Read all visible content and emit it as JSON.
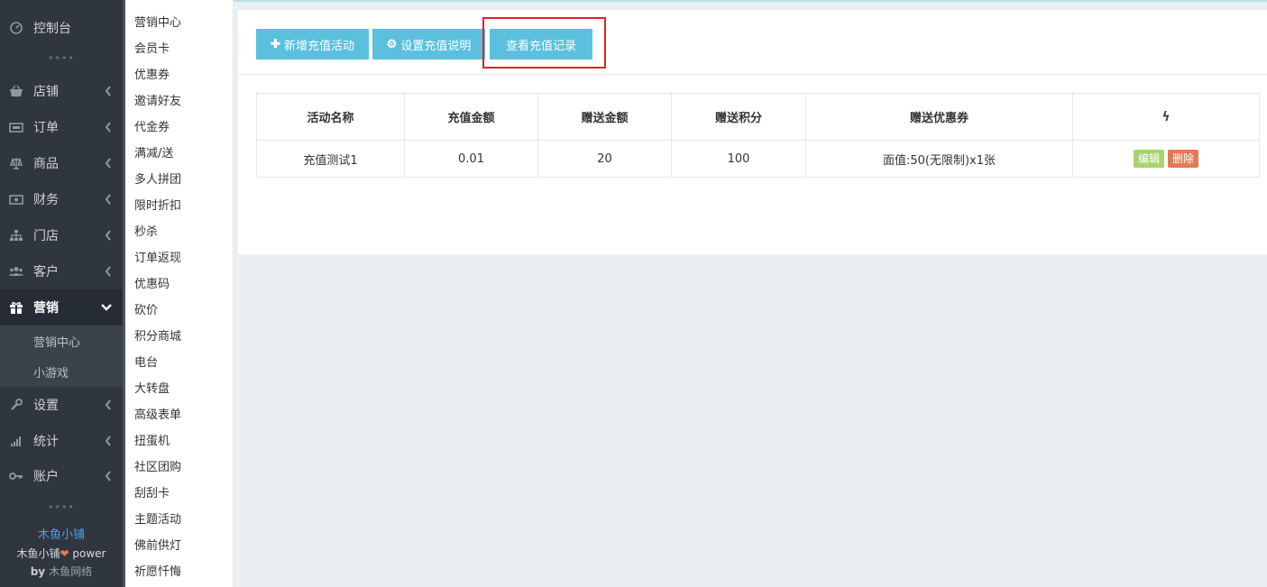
{
  "sidebar": {
    "items": [
      {
        "label": "控制台",
        "icon": "dashboard-icon"
      },
      {
        "label": "店铺",
        "icon": "basket-icon"
      },
      {
        "label": "订单",
        "icon": "ticket-icon"
      },
      {
        "label": "商品",
        "icon": "balance-scale-icon"
      },
      {
        "label": "财务",
        "icon": "money-icon"
      },
      {
        "label": "门店",
        "icon": "sitemap-icon"
      },
      {
        "label": "客户",
        "icon": "users-icon"
      },
      {
        "label": "营销",
        "icon": "gift-icon"
      },
      {
        "label": "设置",
        "icon": "wrench-icon"
      },
      {
        "label": "统计",
        "icon": "signal-icon"
      },
      {
        "label": "账户",
        "icon": "key-icon"
      }
    ],
    "sub_items": [
      "营销中心",
      "小游戏"
    ],
    "dots": "••••",
    "footer": {
      "brand": "木鱼小铺",
      "power_prefix": "木鱼小铺",
      "power_suffix": " power",
      "by_prefix": "by ",
      "by_name": "木鱼网络"
    }
  },
  "submenu": {
    "items": [
      "营销中心",
      "会员卡",
      "优惠券",
      "邀请好友",
      "代金券",
      "满减/送",
      "多人拼团",
      "限时折扣",
      "秒杀",
      "订单返现",
      "优惠码",
      "砍价",
      "积分商城",
      "电台",
      "大转盘",
      "高级表单",
      "扭蛋机",
      "社区团购",
      "刮刮卡",
      "主题活动",
      "佛前供灯",
      "祈愿忏悔"
    ]
  },
  "toolbar": {
    "add_label": "新增充值活动",
    "settings_label": "设置充值说明",
    "records_label": "查看充值记录"
  },
  "table": {
    "headers": [
      "活动名称",
      "充值金额",
      "赠送金额",
      "赠送积分",
      "赠送优惠券"
    ],
    "rows": [
      {
        "name": "充值测试1",
        "amount": "0.01",
        "gift_amount": "20",
        "gift_points": "100",
        "coupon": "面值:50(无限制)x1张"
      }
    ],
    "edit_label": "编辑",
    "delete_label": "删除"
  },
  "colors": {
    "accent": "#5bc0de",
    "sidebar": "#2f3640",
    "highlight": "#e02424",
    "edit": "#a8d46f",
    "delete": "#e07b54"
  }
}
